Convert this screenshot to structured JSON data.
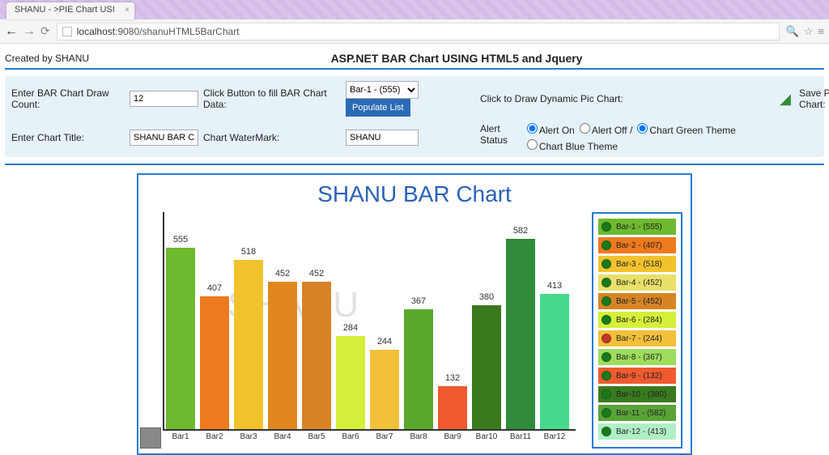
{
  "browser": {
    "tab_title": "SHANU - >PIE Chart USI",
    "url_host": "localhost",
    "url_port": ":9080",
    "url_path": "/shanuHTML5BarChart"
  },
  "header": {
    "created_by": "Created by SHANU",
    "page_title": "ASP.NET BAR Chart USING HTML5 and Jquery"
  },
  "controls": {
    "draw_count_label": "Enter BAR Chart Draw Count:",
    "draw_count_value": "12",
    "fill_data_label": "Click Button to fill BAR Chart Data:",
    "select_value": "Bar-1 - (555)",
    "populate_btn": "Populate List",
    "dynamic_label": "Click to Draw Dynamic Pic Chart:",
    "title_label": "Enter Chart Title:",
    "title_value": "SHANU BAR Chart",
    "watermark_label": "Chart WaterMark:",
    "watermark_value": "SHANU",
    "alert_label": "Alert Status",
    "alert_on": "Alert On",
    "alert_off": "Alert Off /",
    "theme_green": "Chart Green Theme",
    "theme_blue": "Chart Blue Theme",
    "save_label": "Save Pic Chart:"
  },
  "chart_data": {
    "type": "bar",
    "title": "SHANU BAR Chart",
    "watermark": "SHANU",
    "xlabel": "",
    "ylabel": "",
    "ylim": [
      0,
      600
    ],
    "categories": [
      "Bar1",
      "Bar2",
      "Bar3",
      "Bar4",
      "Bar5",
      "Bar6",
      "Bar7",
      "Bar8",
      "Bar9",
      "Bar10",
      "Bar11",
      "Bar12"
    ],
    "values": [
      555,
      407,
      518,
      452,
      452,
      284,
      244,
      367,
      132,
      380,
      582,
      413
    ],
    "colors": [
      "#6fb92f",
      "#ef7a1f",
      "#f2c22e",
      "#e0881f",
      "#d68425",
      "#d6ef3a",
      "#f2c13a",
      "#5aa82c",
      "#ef5a2f",
      "#3a7a1f",
      "#2f8b3a",
      "#46d98b"
    ],
    "legend": [
      {
        "label": "Bar-1 - (555)",
        "bg": "#6fb92f"
      },
      {
        "label": "Bar-2 - (407)",
        "bg": "#ef7a1f"
      },
      {
        "label": "Bar-3 - (518)",
        "bg": "#f2c22e"
      },
      {
        "label": "Bar-4 - (452)",
        "bg": "#e9e06a"
      },
      {
        "label": "Bar-5 - (452)",
        "bg": "#d68425"
      },
      {
        "label": "Bar-6 - (284)",
        "bg": "#d6ef3a"
      },
      {
        "label": "Bar-7 - (244)",
        "bg": "#f2c13a",
        "dot": "#c0392b"
      },
      {
        "label": "Bar-8 - (367)",
        "bg": "#9edc5c"
      },
      {
        "label": "Bar-9 - (132)",
        "bg": "#ef5a2f"
      },
      {
        "label": "Bar-10 - (380)",
        "bg": "#3a7a1f"
      },
      {
        "label": "Bar-11 - (582)",
        "bg": "#5aa338"
      },
      {
        "label": "Bar-12 - (413)",
        "bg": "#b0efc6"
      }
    ]
  }
}
